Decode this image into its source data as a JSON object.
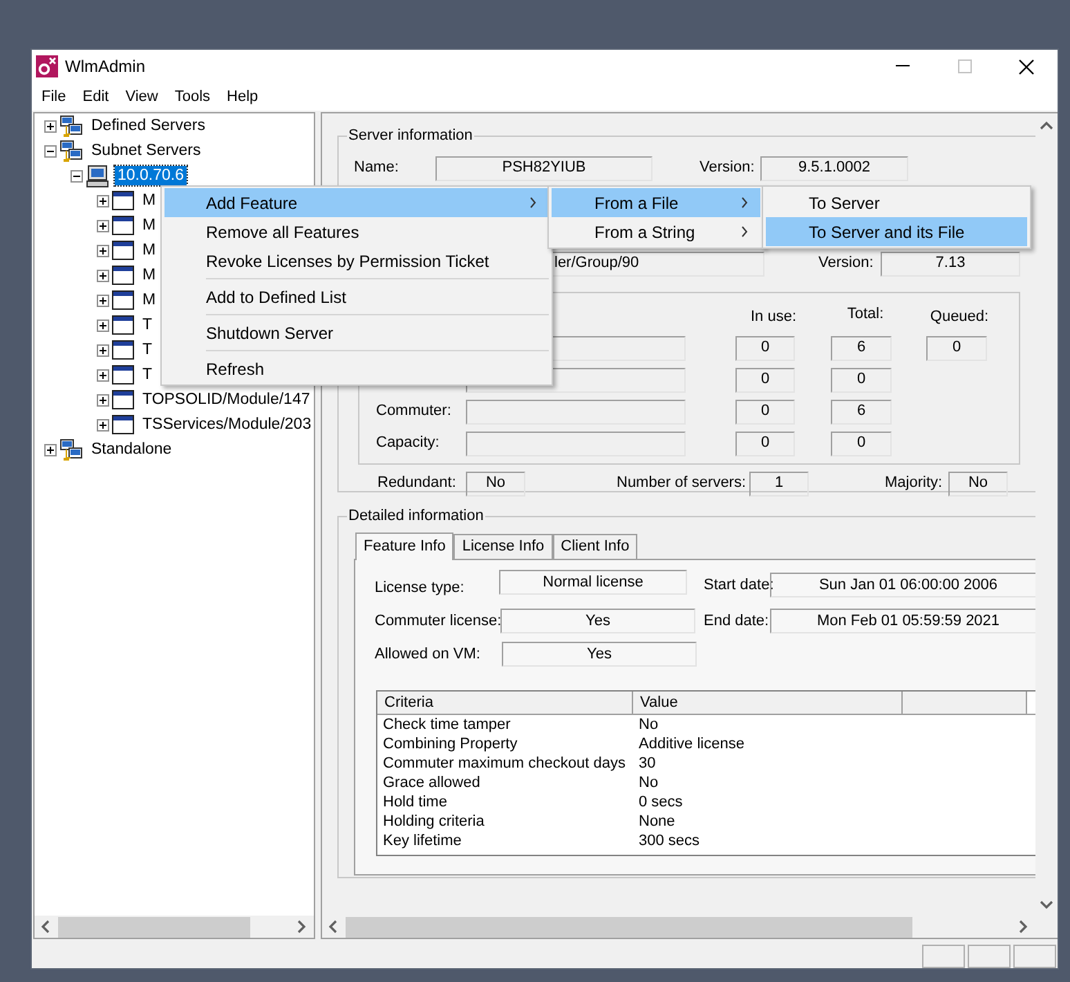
{
  "window": {
    "title": "WlmAdmin"
  },
  "menu_bar": [
    "File",
    "Edit",
    "View",
    "Tools",
    "Help"
  ],
  "tree": [
    {
      "label": "Defined Servers",
      "kind": "group",
      "expanded": false,
      "selected": false
    },
    {
      "label": "Subnet Servers",
      "kind": "group",
      "expanded": true,
      "selected": false,
      "children": [
        {
          "label": "10.0.70.6",
          "kind": "server",
          "expanded": true,
          "selected": true,
          "children": [
            {
              "label": "M",
              "kind": "feature",
              "expanded": false,
              "selected": false
            },
            {
              "label": "M",
              "kind": "feature",
              "expanded": false,
              "selected": false
            },
            {
              "label": "M",
              "kind": "feature",
              "expanded": false,
              "selected": false
            },
            {
              "label": "M",
              "kind": "feature",
              "expanded": false,
              "selected": false
            },
            {
              "label": "M",
              "kind": "feature",
              "expanded": false,
              "selected": false
            },
            {
              "label": "T",
              "kind": "feature",
              "expanded": false,
              "selected": false
            },
            {
              "label": "T",
              "kind": "feature",
              "expanded": false,
              "selected": false
            },
            {
              "label": "T",
              "kind": "feature",
              "expanded": false,
              "selected": false
            },
            {
              "label": "TOPSOLID/Module/147",
              "kind": "feature",
              "expanded": false,
              "selected": false
            },
            {
              "label": "TSServices/Module/203",
              "kind": "feature",
              "expanded": false,
              "selected": false
            }
          ]
        }
      ]
    },
    {
      "label": "Standalone",
      "kind": "group",
      "expanded": false,
      "selected": false
    }
  ],
  "context_menu": {
    "items": [
      {
        "kind": "item",
        "label": "Add Feature",
        "selected": true,
        "has_submenu": true
      },
      {
        "kind": "item",
        "label": "Remove all Features",
        "selected": false,
        "has_submenu": false
      },
      {
        "kind": "item",
        "label": "Revoke Licenses by Permission Ticket",
        "selected": false,
        "has_submenu": false
      },
      {
        "kind": "separator"
      },
      {
        "kind": "item",
        "label": "Add to Defined List",
        "selected": false,
        "has_submenu": false
      },
      {
        "kind": "separator"
      },
      {
        "kind": "item",
        "label": "Shutdown Server",
        "selected": false,
        "has_submenu": false
      },
      {
        "kind": "separator"
      },
      {
        "kind": "item",
        "label": "Refresh",
        "selected": false,
        "has_submenu": false
      }
    ]
  },
  "submenu": {
    "items": [
      {
        "kind": "item",
        "label": "From a File",
        "selected": true,
        "has_submenu": true
      },
      {
        "kind": "item",
        "label": "From a String",
        "selected": false,
        "has_submenu": true
      }
    ]
  },
  "submenu_2": {
    "items": [
      {
        "kind": "item",
        "label": "To Server",
        "selected": false,
        "has_submenu": false
      },
      {
        "kind": "item",
        "label": "To Server and its File",
        "selected": true,
        "has_submenu": false
      }
    ]
  },
  "server_information": {
    "title": "Server information",
    "name_label": "Name:",
    "name": "PSH82YIUB",
    "version_label": "Version:",
    "version": "9.5.1.0002",
    "feature_name": "ler/Group/90",
    "feature_version_label": "Version:",
    "feature_version": "7.13",
    "columns": [
      "In use:",
      "Total:",
      "Queued:"
    ],
    "license_rows": [
      {
        "in_use": "0",
        "total": "6",
        "queued": "0"
      },
      {
        "in_use": "0",
        "total": "0"
      },
      {
        "label": "Commuter:",
        "in_use": "0",
        "total": "6"
      },
      {
        "label": "Capacity:",
        "in_use": "0",
        "total": "0"
      }
    ],
    "redundant_label": "Redundant:",
    "redundant": "No",
    "servers_label": "Number of servers:",
    "servers": "1",
    "majority_label": "Majority:",
    "majority": "No"
  },
  "detailed_information": {
    "title": "Detailed information",
    "tabs": [
      {
        "label": "Feature Info",
        "selected": true
      },
      {
        "label": "License Info",
        "selected": false
      },
      {
        "label": "Client Info",
        "selected": false
      }
    ],
    "license_type_label": "License type:",
    "license_type": "Normal license",
    "start_date_label": "Start date:",
    "start_date": "Sun Jan 01 06:00:00 2006",
    "commuter_label": "Commuter license:",
    "commuter": "Yes",
    "end_date_label": "End date:",
    "end_date": "Mon Feb 01 05:59:59 2021",
    "vm_label": "Allowed on VM:",
    "vm": "Yes",
    "table": {
      "columns": [
        "Criteria",
        "Value"
      ],
      "rows": [
        [
          "Check time tamper",
          "No"
        ],
        [
          "Combining Property",
          "Additive license"
        ],
        [
          "Commuter maximum checkout days",
          "30"
        ],
        [
          "Grace allowed",
          "No"
        ],
        [
          "Hold time",
          "0 secs"
        ],
        [
          "Holding criteria",
          "None"
        ],
        [
          "Key lifetime",
          "300 secs"
        ]
      ]
    }
  }
}
